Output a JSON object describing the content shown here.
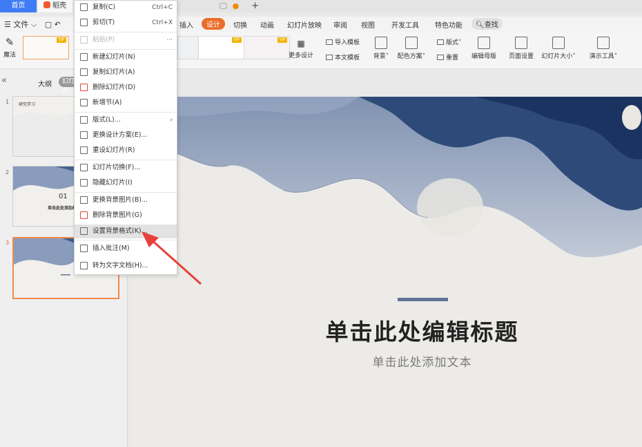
{
  "titlebar": {
    "home_tab": "首页",
    "doc_tab": "稻壳"
  },
  "menubar": {
    "file": "文件",
    "tabs": [
      "插入",
      "设计",
      "切换",
      "动画",
      "幻灯片放映",
      "审阅",
      "视图",
      "开发工具",
      "特色功能"
    ],
    "active_tab": "设计",
    "search": "查找"
  },
  "ribbon": {
    "magic": "魔法",
    "vip": "VIP",
    "more_design": "更多设计",
    "import_template": "导入模板",
    "this_template": "本文模板",
    "background": "背景",
    "color_scheme": "配色方案",
    "layout": "版式",
    "reset": "重置",
    "edit_master": "编辑母版",
    "page_setup": "页面设置",
    "slide_size": "幻灯片大小",
    "presentation_tools": "演示工具"
  },
  "leftpane": {
    "outline": "大纲",
    "slides": "幻灯片",
    "slide_numbers": [
      "1",
      "2",
      "3"
    ],
    "thumb1_title": "研究学习",
    "thumb2_num": "01",
    "thumb2_title": "单击此处添加标题"
  },
  "context_menu": {
    "items": [
      {
        "label": "复制(C)",
        "shortcut": "Ctrl+C",
        "icon": "copy-icon",
        "disabled": false
      },
      {
        "label": "剪切(T)",
        "shortcut": "Ctrl+X",
        "icon": "scissors-icon",
        "disabled": false
      },
      {
        "label": "粘贴(P)",
        "shortcut": "···",
        "icon": "paste-icon",
        "disabled": true
      },
      {
        "label": "新建幻灯片(N)",
        "shortcut": "",
        "icon": "new-slide-icon",
        "disabled": false
      },
      {
        "label": "复制幻灯片(A)",
        "shortcut": "",
        "icon": "duplicate-slide-icon",
        "disabled": false
      },
      {
        "label": "删除幻灯片(D)",
        "shortcut": "",
        "icon": "delete-slide-icon",
        "disabled": false
      },
      {
        "label": "新增节(A)",
        "shortcut": "",
        "icon": "section-icon",
        "disabled": false
      },
      {
        "label": "版式(L)...",
        "shortcut": "›",
        "icon": "layout-icon",
        "disabled": false
      },
      {
        "label": "更换设计方案(E)...",
        "shortcut": "",
        "icon": "design-icon",
        "disabled": false
      },
      {
        "label": "重设幻灯片(R)",
        "shortcut": "",
        "icon": "reset-slide-icon",
        "disabled": false
      },
      {
        "label": "幻灯片切换(F)...",
        "shortcut": "",
        "icon": "transition-icon",
        "disabled": false
      },
      {
        "label": "隐藏幻灯片(I)",
        "shortcut": "",
        "icon": "hide-slide-icon",
        "disabled": false
      },
      {
        "label": "更换背景图片(B)...",
        "shortcut": "",
        "icon": "change-bg-icon",
        "disabled": false
      },
      {
        "label": "删除背景图片(G)",
        "shortcut": "",
        "icon": "delete-bg-icon",
        "disabled": false
      },
      {
        "label": "设置背景格式(K)...",
        "shortcut": "",
        "icon": "bg-format-icon",
        "disabled": false
      },
      {
        "label": "插入批注(M)",
        "shortcut": "",
        "icon": "comment-icon",
        "disabled": false
      },
      {
        "label": "转为文字文档(H)...",
        "shortcut": "",
        "icon": "to-doc-icon",
        "disabled": false
      }
    ]
  },
  "slide": {
    "title": "单击此处编辑标题",
    "subtitle": "单击此处添加文本"
  },
  "colors": {
    "accent": "#ea6d2b",
    "home_tab": "#3e7bf5",
    "arrow": "#e8403a",
    "ink": "#2e4a78"
  }
}
